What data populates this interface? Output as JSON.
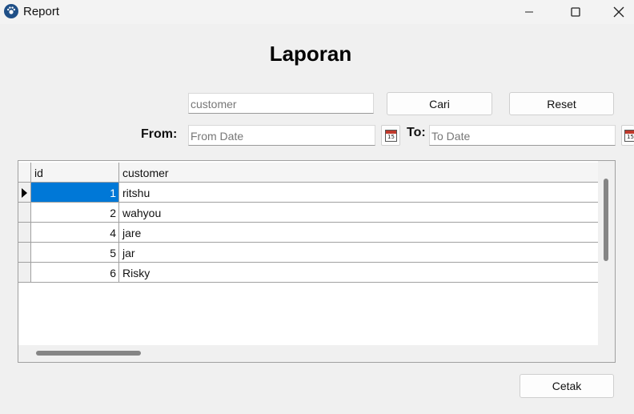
{
  "window": {
    "title": "Report",
    "app_icon": "paw-icon"
  },
  "heading": "Laporan",
  "search": {
    "placeholder": "customer",
    "value": ""
  },
  "buttons": {
    "search": "Cari",
    "reset": "Reset",
    "print": "Cetak"
  },
  "date_filter": {
    "from_label": "From:",
    "from_placeholder": "From Date",
    "to_label": "To:",
    "to_placeholder": "To Date",
    "calendar_day": "15"
  },
  "table": {
    "columns": [
      "id",
      "customer"
    ],
    "rows": [
      {
        "id": "1",
        "customer": "ritshu"
      },
      {
        "id": "2",
        "customer": "wahyou"
      },
      {
        "id": "4",
        "customer": "jare"
      },
      {
        "id": "5",
        "customer": "jar"
      },
      {
        "id": "6",
        "customer": "Risky"
      }
    ],
    "selected_row": 0
  },
  "colors": {
    "selection": "#0078d7"
  }
}
